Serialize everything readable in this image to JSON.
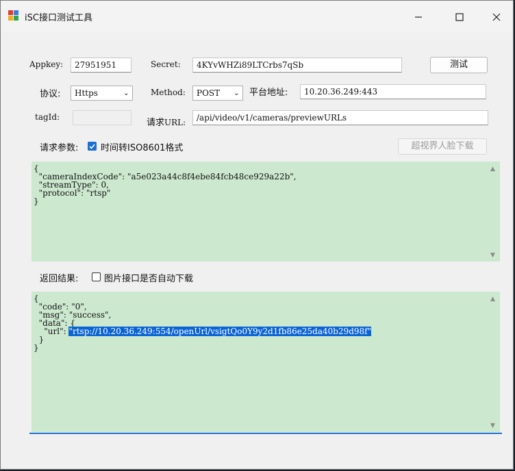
{
  "window": {
    "title": "iSC接口测试工具"
  },
  "controls": {
    "minimize_icon": "minimize-icon",
    "maximize_icon": "maximize-icon",
    "close_icon": "close-icon"
  },
  "form": {
    "appkey_label": "Appkey:",
    "appkey_value": "27951951",
    "secret_label": "Secret:",
    "secret_value": "4KYvWHZi89LTCrbs7qSb",
    "test_button": "测试",
    "protocol_label": "协议:",
    "protocol_value": "Https",
    "method_label": "Method:",
    "method_value": "POST",
    "platform_label": "平台地址:",
    "platform_value": "10.20.36.249:443",
    "tagid_label": "tagId:",
    "tagid_value": "",
    "url_label_cn": "请求",
    "url_label_en": "URL:",
    "url_value": "/api/video/v1/cameras/previewURLs"
  },
  "request": {
    "params_label": "请求参数:",
    "iso_checkbox_label": "时间转ISO8601格式",
    "iso_checked": true,
    "face_download_button": "超视界人脸下载",
    "body": "{\n  \"cameraIndexCode\": \"a5e023a44c8f4ebe84fcb48ce929a22b\",\n  \"streamType\": 0,\n  \"protocol\": \"rtsp\"\n}"
  },
  "response": {
    "result_label": "返回结果:",
    "auto_download_label": "图片接口是否自动下载",
    "auto_download_checked": false,
    "line1": "{",
    "line2": "  \"code\": \"0\",",
    "line3": "  \"msg\": \"success\",",
    "line4": "  \"data\": {",
    "line5_prefix": "    \"url\": ",
    "line5_value": "\"rtsp://10.20.36.249:554/openUrl/vsigtQo0Y9y2d1fb86e25da40b29d98f\"",
    "line6": "  }",
    "line7": "}"
  }
}
